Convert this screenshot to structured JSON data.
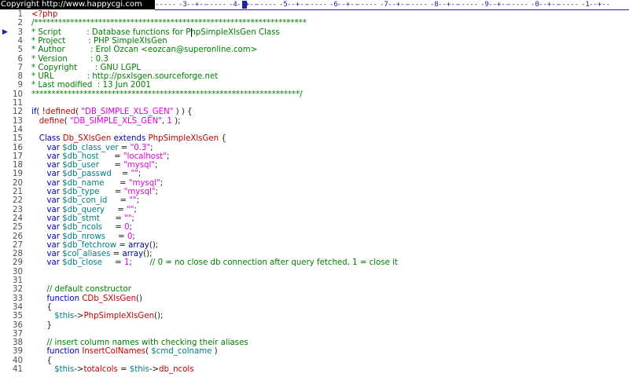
{
  "header": {
    "copyright": "Copyright  http://www.happycgi.com",
    "ruler_segments": [
      "-3",
      "-4",
      "-5",
      "-6",
      "-7",
      "-8",
      "-9",
      "-0",
      "-1"
    ]
  },
  "editor": {
    "current_line": 3,
    "colors": {
      "comment": "#008000",
      "keyword": "#0000c0",
      "variable": "#008080",
      "string": "#e000e0",
      "identifier": "#c00000"
    },
    "lines": [
      {
        "n": "1",
        "tokens": [
          [
            "tag",
            "<?php"
          ]
        ]
      },
      {
        "n": "2",
        "tokens": [
          [
            "comment",
            "/********************************************************************"
          ]
        ]
      },
      {
        "n": "3",
        "marker": "▶",
        "tokens": [
          [
            "comment",
            "* Script          : Database functions for PhpSimpleXlsGen Class"
          ]
        ]
      },
      {
        "n": "4",
        "tokens": [
          [
            "comment",
            "* Project         : PHP SimpleXlsGen"
          ]
        ]
      },
      {
        "n": "5",
        "tokens": [
          [
            "comment",
            "* Author          : Erol Ozcan <eozcan@superonline.com>"
          ]
        ]
      },
      {
        "n": "6",
        "tokens": [
          [
            "comment",
            "* Version         : 0.3"
          ]
        ]
      },
      {
        "n": "7",
        "tokens": [
          [
            "comment",
            "* Copyright       : GNU LGPL"
          ]
        ]
      },
      {
        "n": "8",
        "tokens": [
          [
            "comment",
            "* URL             : http://psxlsgen.sourceforge.net"
          ]
        ]
      },
      {
        "n": "9",
        "tokens": [
          [
            "comment",
            "* Last modified  : 13 Jun 2001"
          ]
        ]
      },
      {
        "n": "10",
        "tokens": [
          [
            "comment",
            "*******************************************************************/"
          ]
        ]
      },
      {
        "n": "11",
        "tokens": []
      },
      {
        "n": "12",
        "tokens": [
          [
            "kw",
            "if"
          ],
          [
            "punct",
            "( "
          ],
          [
            "punct",
            "!"
          ],
          [
            "plain",
            "defined"
          ],
          [
            "punct",
            "( "
          ],
          [
            "str",
            "\"DB_SIMPLE_XLS_GEN\""
          ],
          [
            "punct",
            " ) ) {"
          ]
        ]
      },
      {
        "n": "13",
        "tokens": [
          [
            "punct",
            "   "
          ],
          [
            "plain",
            "define"
          ],
          [
            "punct",
            "( "
          ],
          [
            "str",
            "\"DB_SIMPLE_XLS_GEN\""
          ],
          [
            "punct",
            ", "
          ],
          [
            "num",
            "1"
          ],
          [
            "punct",
            " );"
          ]
        ]
      },
      {
        "n": "14",
        "tokens": []
      },
      {
        "n": "15",
        "tokens": [
          [
            "punct",
            "   "
          ],
          [
            "kw",
            "Class"
          ],
          [
            "punct",
            " "
          ],
          [
            "plain",
            "Db_SXlsGen"
          ],
          [
            "punct",
            " "
          ],
          [
            "kw",
            "extends"
          ],
          [
            "punct",
            " "
          ],
          [
            "plain",
            "PhpSimpleXlsGen"
          ],
          [
            "punct",
            " {"
          ]
        ]
      },
      {
        "n": "16",
        "tokens": [
          [
            "punct",
            "      "
          ],
          [
            "kw",
            "var"
          ],
          [
            "punct",
            " "
          ],
          [
            "var",
            "$db_class_ver"
          ],
          [
            "punct",
            " = "
          ],
          [
            "str",
            "\"0.3\""
          ],
          [
            "punct",
            ";"
          ]
        ]
      },
      {
        "n": "17",
        "tokens": [
          [
            "punct",
            "      "
          ],
          [
            "kw",
            "var"
          ],
          [
            "punct",
            " "
          ],
          [
            "var",
            "$db_host"
          ],
          [
            "punct",
            "      = "
          ],
          [
            "str",
            "\"localhost\""
          ],
          [
            "punct",
            ";"
          ]
        ]
      },
      {
        "n": "18",
        "tokens": [
          [
            "punct",
            "      "
          ],
          [
            "kw",
            "var"
          ],
          [
            "punct",
            " "
          ],
          [
            "var",
            "$db_user"
          ],
          [
            "punct",
            "      = "
          ],
          [
            "str",
            "\"mysql\""
          ],
          [
            "punct",
            ";"
          ]
        ]
      },
      {
        "n": "19",
        "tokens": [
          [
            "punct",
            "      "
          ],
          [
            "kw",
            "var"
          ],
          [
            "punct",
            " "
          ],
          [
            "var",
            "$db_passwd"
          ],
          [
            "punct",
            "    = "
          ],
          [
            "str",
            "\"\""
          ],
          [
            "punct",
            ";"
          ]
        ]
      },
      {
        "n": "20",
        "tokens": [
          [
            "punct",
            "      "
          ],
          [
            "kw",
            "var"
          ],
          [
            "punct",
            " "
          ],
          [
            "var",
            "$db_name"
          ],
          [
            "punct",
            "      = "
          ],
          [
            "str",
            "\"mysql\""
          ],
          [
            "punct",
            ";"
          ]
        ]
      },
      {
        "n": "21",
        "tokens": [
          [
            "punct",
            "      "
          ],
          [
            "kw",
            "var"
          ],
          [
            "punct",
            " "
          ],
          [
            "var",
            "$db_type"
          ],
          [
            "punct",
            "      = "
          ],
          [
            "str",
            "\"mysql\""
          ],
          [
            "punct",
            ";"
          ]
        ]
      },
      {
        "n": "22",
        "tokens": [
          [
            "punct",
            "      "
          ],
          [
            "kw",
            "var"
          ],
          [
            "punct",
            " "
          ],
          [
            "var",
            "$db_con_id"
          ],
          [
            "punct",
            "     = "
          ],
          [
            "str",
            "\"\""
          ],
          [
            "punct",
            ";"
          ]
        ]
      },
      {
        "n": "23",
        "tokens": [
          [
            "punct",
            "      "
          ],
          [
            "kw",
            "var"
          ],
          [
            "punct",
            " "
          ],
          [
            "var",
            "$db_query"
          ],
          [
            "punct",
            "     = "
          ],
          [
            "str",
            "\"\""
          ],
          [
            "punct",
            ";"
          ]
        ]
      },
      {
        "n": "24",
        "tokens": [
          [
            "punct",
            "      "
          ],
          [
            "kw",
            "var"
          ],
          [
            "punct",
            " "
          ],
          [
            "var",
            "$db_stmt"
          ],
          [
            "punct",
            "      = "
          ],
          [
            "str",
            "\"\""
          ],
          [
            "punct",
            ";"
          ]
        ]
      },
      {
        "n": "25",
        "tokens": [
          [
            "punct",
            "      "
          ],
          [
            "kw",
            "var"
          ],
          [
            "punct",
            " "
          ],
          [
            "var",
            "$db_ncols"
          ],
          [
            "punct",
            "     = "
          ],
          [
            "num",
            "0"
          ],
          [
            "punct",
            ";"
          ]
        ]
      },
      {
        "n": "26",
        "tokens": [
          [
            "punct",
            "      "
          ],
          [
            "kw",
            "var"
          ],
          [
            "punct",
            " "
          ],
          [
            "var",
            "$db_nrows"
          ],
          [
            "punct",
            "     = "
          ],
          [
            "num",
            "0"
          ],
          [
            "punct",
            ";"
          ]
        ]
      },
      {
        "n": "27",
        "tokens": [
          [
            "punct",
            "      "
          ],
          [
            "kw",
            "var"
          ],
          [
            "punct",
            " "
          ],
          [
            "var",
            "$db_fetchrow"
          ],
          [
            "punct",
            " = "
          ],
          [
            "kw",
            "array"
          ],
          [
            "punct",
            "();"
          ]
        ]
      },
      {
        "n": "28",
        "tokens": [
          [
            "punct",
            "      "
          ],
          [
            "kw",
            "var"
          ],
          [
            "punct",
            " "
          ],
          [
            "var",
            "$col_aliases"
          ],
          [
            "punct",
            " = "
          ],
          [
            "kw",
            "array"
          ],
          [
            "punct",
            "();"
          ]
        ]
      },
      {
        "n": "29",
        "tokens": [
          [
            "punct",
            "      "
          ],
          [
            "kw",
            "var"
          ],
          [
            "punct",
            " "
          ],
          [
            "var",
            "$db_close"
          ],
          [
            "punct",
            "     = "
          ],
          [
            "num",
            "1"
          ],
          [
            "punct",
            ";       "
          ],
          [
            "comment",
            "// 0 = no close db connection after query fetched, 1 = close it"
          ]
        ]
      },
      {
        "n": "30",
        "tokens": []
      },
      {
        "n": "31",
        "tokens": []
      },
      {
        "n": "32",
        "tokens": [
          [
            "punct",
            "      "
          ],
          [
            "comment",
            "// default constructor"
          ]
        ]
      },
      {
        "n": "33",
        "tokens": [
          [
            "punct",
            "      "
          ],
          [
            "kw",
            "function"
          ],
          [
            "punct",
            " "
          ],
          [
            "plain",
            "CDb_SXlsGen"
          ],
          [
            "punct",
            "()"
          ]
        ]
      },
      {
        "n": "34",
        "tokens": [
          [
            "punct",
            "      "
          ],
          [
            "punct",
            "{"
          ]
        ]
      },
      {
        "n": "35",
        "tokens": [
          [
            "punct",
            "         "
          ],
          [
            "var",
            "$this"
          ],
          [
            "punct",
            "->"
          ],
          [
            "plain",
            "PhpSimpleXlsGen"
          ],
          [
            "punct",
            "();"
          ]
        ]
      },
      {
        "n": "36",
        "tokens": [
          [
            "punct",
            "      "
          ],
          [
            "punct",
            "}"
          ]
        ]
      },
      {
        "n": "37",
        "tokens": []
      },
      {
        "n": "38",
        "tokens": [
          [
            "punct",
            "      "
          ],
          [
            "comment",
            "// insert column names with checking their aliases"
          ]
        ]
      },
      {
        "n": "39",
        "tokens": [
          [
            "punct",
            "      "
          ],
          [
            "kw",
            "function"
          ],
          [
            "punct",
            " "
          ],
          [
            "plain",
            "InsertColNames"
          ],
          [
            "punct",
            "( "
          ],
          [
            "var",
            "$cmd_colname"
          ],
          [
            "punct",
            " )"
          ]
        ]
      },
      {
        "n": "40",
        "tokens": [
          [
            "punct",
            "      "
          ],
          [
            "punct",
            "{"
          ]
        ]
      },
      {
        "n": "41",
        "tokens": [
          [
            "punct",
            "         "
          ],
          [
            "var",
            "$this"
          ],
          [
            "punct",
            "->"
          ],
          [
            "plain",
            "totalcols"
          ],
          [
            "punct",
            " = "
          ],
          [
            "var",
            "$this"
          ],
          [
            "punct",
            "->"
          ],
          [
            "plain",
            "db_ncols"
          ]
        ]
      }
    ]
  }
}
